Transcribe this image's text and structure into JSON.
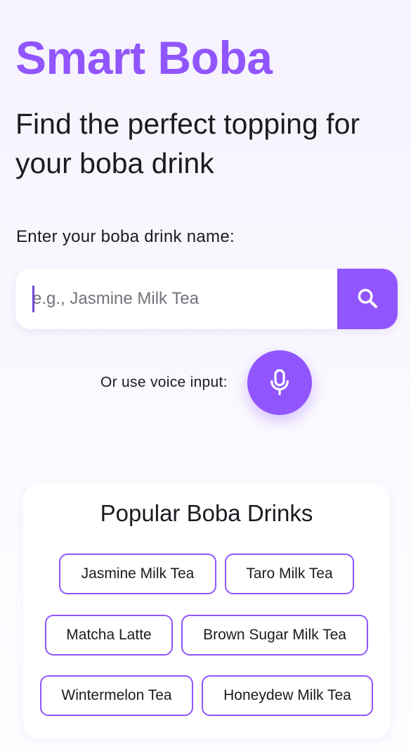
{
  "header": {
    "title": "Smart Boba",
    "subtitle": "Find the perfect topping for your boba drink"
  },
  "search": {
    "label": "Enter your boba drink name:",
    "placeholder": "e.g., Jasmine Milk Tea",
    "value": "",
    "button_icon": "search-icon"
  },
  "voice": {
    "label": "Or use voice input:",
    "button_icon": "microphone-icon"
  },
  "popular": {
    "title": "Popular Boba Drinks",
    "drinks": [
      "Jasmine Milk Tea",
      "Taro Milk Tea",
      "Matcha Latte",
      "Brown Sugar Milk Tea",
      "Wintermelon Tea",
      "Honeydew Milk Tea"
    ]
  },
  "colors": {
    "accent": "#9155fd",
    "text": "#1c1b22",
    "background": "#f6f2fe"
  }
}
